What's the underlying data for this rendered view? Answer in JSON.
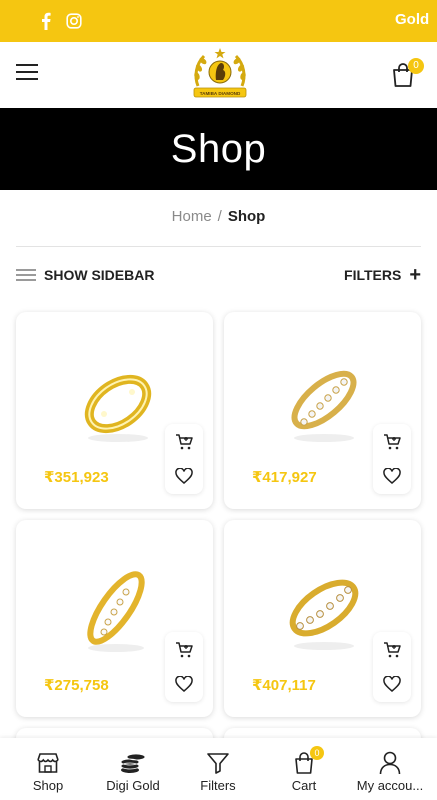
{
  "topbar": {
    "ticker_text": "Gold ",
    "social": [
      "facebook-icon",
      "instagram-icon"
    ]
  },
  "header": {
    "logo_text": "TAMIBA DIAMOND",
    "cart_count": "0"
  },
  "banner": {
    "title": "Shop"
  },
  "breadcrumb": {
    "home": "Home",
    "separator": "/",
    "current": "Shop"
  },
  "toolbar": {
    "show_sidebar": "SHOW SIDEBAR",
    "filters": "FILTERS",
    "filters_icon": "+"
  },
  "products": [
    {
      "price": "₹351,923"
    },
    {
      "price": "₹417,927"
    },
    {
      "price": "₹275,758"
    },
    {
      "price": "₹407,117"
    }
  ],
  "bottom_nav": {
    "items": [
      {
        "label": "Shop",
        "icon": "store-icon"
      },
      {
        "label": "Digi Gold",
        "icon": "coins-icon"
      },
      {
        "label": "Filters",
        "icon": "filter-icon"
      },
      {
        "label": "Cart",
        "icon": "cart-icon"
      },
      {
        "label": "My accou...",
        "icon": "user-icon"
      }
    ],
    "cart_badge": "0"
  },
  "colors": {
    "accent": "#f5c611",
    "banner_bg": "#000000",
    "text": "#222222"
  }
}
